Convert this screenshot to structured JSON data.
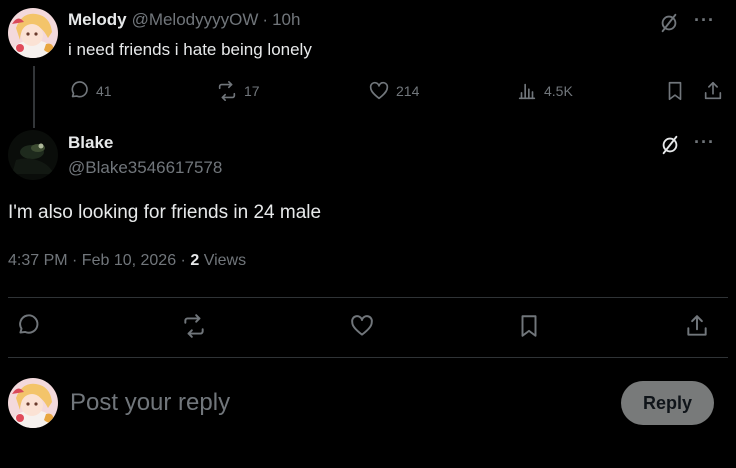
{
  "parent_post": {
    "author_name": "Melody",
    "author_handle": "@MelodyyyyOW",
    "separator": "·",
    "time_ago": "10h",
    "text": "i need friends i hate being lonely",
    "stats": {
      "replies": "41",
      "reposts": "17",
      "likes": "214",
      "views": "4.5K"
    },
    "more_glyph": "···"
  },
  "main_post": {
    "author_name": "Blake",
    "author_handle": "@Blake3546617578",
    "text": "I'm also looking for friends in 24 male",
    "timestamp": "4:37 PM · Feb 10, 2026 · ",
    "views_count": "2",
    "views_label": "Views",
    "more_glyph": "···"
  },
  "reply_composer": {
    "placeholder": "Post your reply",
    "button_label": "Reply"
  },
  "icons": {
    "reply": "reply-icon",
    "repost": "repost-icon",
    "like": "heart-icon",
    "views": "views-icon",
    "bookmark": "bookmark-icon",
    "share": "share-icon",
    "grok": "grok-icon",
    "more": "more-icon"
  },
  "colors": {
    "background": "#000000",
    "text_primary": "#e7e9ea",
    "text_secondary": "#71767b",
    "divider": "#2f3336",
    "reply_button_bg": "#787a7a"
  }
}
